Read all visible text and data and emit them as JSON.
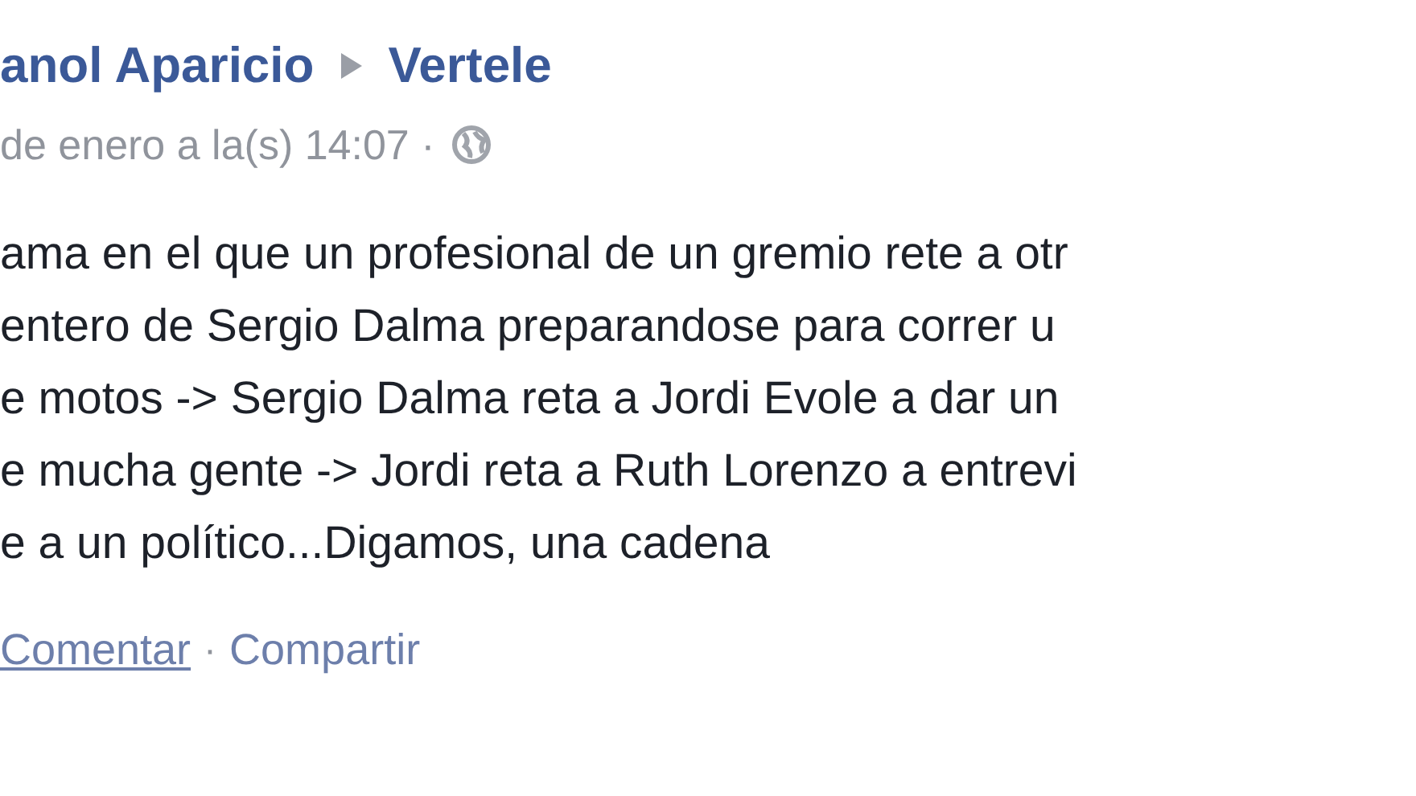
{
  "header": {
    "author": "anol Aparicio",
    "target": "Vertele",
    "timestamp": "de enero a la(s) 14:07 ·"
  },
  "body_lines": [
    "ama en el que un profesional de un gremio rete a otr",
    "entero de Sergio Dalma preparandose para correr u",
    "e motos -> Sergio Dalma reta a Jordi Evole a dar un",
    "e mucha gente -> Jordi reta a Ruth Lorenzo a entrevi",
    "e a un político...Digamos, una cadena"
  ],
  "actions": [
    {
      "label": "Comentar",
      "hovered": true
    },
    {
      "label": "Compartir",
      "hovered": false
    }
  ],
  "action_separator": "·"
}
